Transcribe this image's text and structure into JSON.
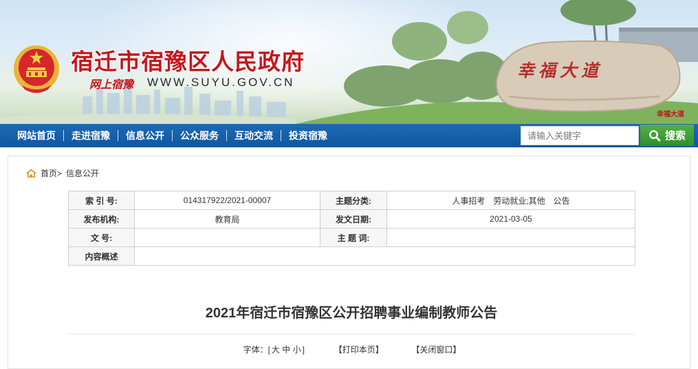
{
  "header": {
    "site_title": "宿迁市宿豫区人民政府",
    "tagline": "网上宿豫",
    "domain": "WWW.SUYU.GOV.CN",
    "stone_text": "幸福大道",
    "stone_caption": "幸福大道"
  },
  "nav": {
    "items": [
      {
        "label": "网站首页"
      },
      {
        "label": "走进宿豫"
      },
      {
        "label": "信息公开"
      },
      {
        "label": "公众服务"
      },
      {
        "label": "互动交流"
      },
      {
        "label": "投资宿豫"
      }
    ],
    "search_placeholder": "请输入关键字",
    "search_button": "搜索"
  },
  "breadcrumb": {
    "home": "首页>",
    "current": "信息公开"
  },
  "meta": {
    "index_no_label": "索 引 号:",
    "index_no": "014317922/2021-00007",
    "category_label": "主题分类:",
    "category": "人事招考　劳动就业;其他　公告",
    "publisher_label": "发布机构:",
    "publisher": "教育局",
    "date_label": "发文日期:",
    "date": "2021-03-05",
    "doc_no_label": "文 号:",
    "doc_no": "",
    "keywords_label": "主 题 词:",
    "keywords": "",
    "summary_label": "内容概述",
    "summary": ""
  },
  "article": {
    "title": "2021年宿迁市宿豫区公开招聘事业编制教师公告",
    "font_label": "字体：[",
    "font_large": "大",
    "font_medium": "中",
    "font_small": "小",
    "font_close": "]",
    "print_label": "【打印本页】",
    "close_label": "【关闭窗口】"
  },
  "colors": {
    "nav_blue": "#0e57a1",
    "title_red": "#c4161c",
    "search_green": "#3a9a30"
  }
}
